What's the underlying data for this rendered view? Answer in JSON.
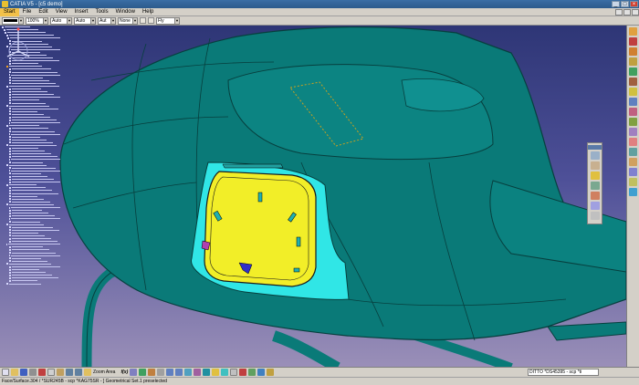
{
  "window": {
    "title": "CATIA V5 - [c5 demo]",
    "minimize": "_",
    "maximize": "□",
    "close": "×"
  },
  "menu": {
    "items": [
      "Start",
      "File",
      "Edit",
      "View",
      "Insert",
      "Tools",
      "Window",
      "Help"
    ],
    "active": "Start"
  },
  "toolbar": {
    "combos": [
      {
        "name": "line-color",
        "value": ""
      },
      {
        "name": "transparency",
        "value": "100%"
      },
      {
        "name": "line-thickness",
        "value": "Auto"
      },
      {
        "name": "line-type",
        "value": "Auto"
      },
      {
        "name": "point-symbol",
        "value": "Aut"
      },
      {
        "name": "layer",
        "value": "None"
      },
      {
        "name": "render-style",
        "value": "Fly"
      }
    ]
  },
  "bottom_toolbar": {
    "zoom_label": "Zoom Area",
    "fx_label": "f(x)",
    "command_input": "DITTO *DS45395 - scp *ti"
  },
  "status": {
    "text": "Face/Surface.304 / *SUR245B - scp *KAG75SR - ] Geometrical Set.1 preselected"
  },
  "colors": {
    "hull": "#0a7a78",
    "hull_edge": "#073f3e",
    "panel": "#f2ee28",
    "frame": "#30e6e6",
    "bg_top": "#2e3676",
    "bg_bottom": "#9a8fb8"
  }
}
